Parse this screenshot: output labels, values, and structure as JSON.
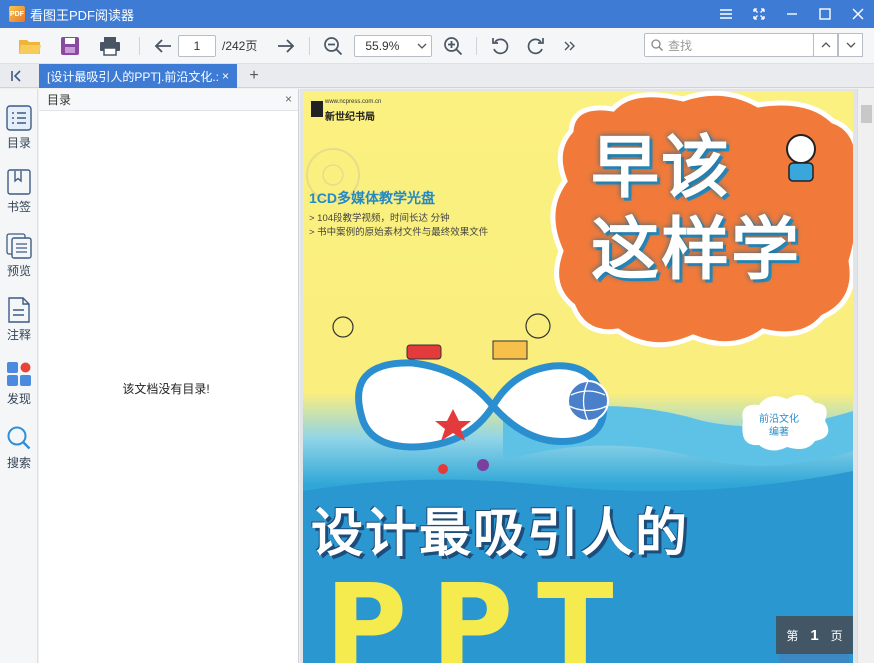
{
  "window": {
    "logo_text": "PDF",
    "title": "看图王PDF阅读器"
  },
  "toolbar": {
    "page_current": "1",
    "page_total": "/242页",
    "zoom": "55.9%",
    "search_placeholder": "查找"
  },
  "tabs": {
    "active_label": "[设计最吸引人的PPT].前沿文化.:",
    "close": "×",
    "new_tab": "+"
  },
  "rail": {
    "items": [
      {
        "label": "目录",
        "icon": "list-icon"
      },
      {
        "label": "书签",
        "icon": "bookmark-icon"
      },
      {
        "label": "预览",
        "icon": "thumbnails-icon"
      },
      {
        "label": "注释",
        "icon": "annotation-icon"
      },
      {
        "label": "发现",
        "icon": "discover-icon"
      },
      {
        "label": "搜索",
        "icon": "search-icon"
      }
    ]
  },
  "outline": {
    "title": "目录",
    "close": "×",
    "empty_message": "该文档没有目录!"
  },
  "document": {
    "publisher_url": "www.ncpress.com.cn",
    "publisher_name": "新世纪书局",
    "cd_line": "1CD多媒体教学光盘",
    "bullets": [
      "> 104段教学视频，时间长达 分钟",
      "> 书中案例的原始素材文件与最终效果文件"
    ],
    "cloud_title_line1": "早该",
    "cloud_title_line2": "这样学",
    "author_line1": "前沿文化",
    "author_line2": "编著",
    "main_title": "设计最吸引人的",
    "main_title_2": "PPT"
  },
  "page_badge": {
    "prefix": "第",
    "number": "1",
    "suffix": "页"
  },
  "colors": {
    "accent": "#3d7bd4",
    "toolbar_icon": "#4a5563"
  }
}
